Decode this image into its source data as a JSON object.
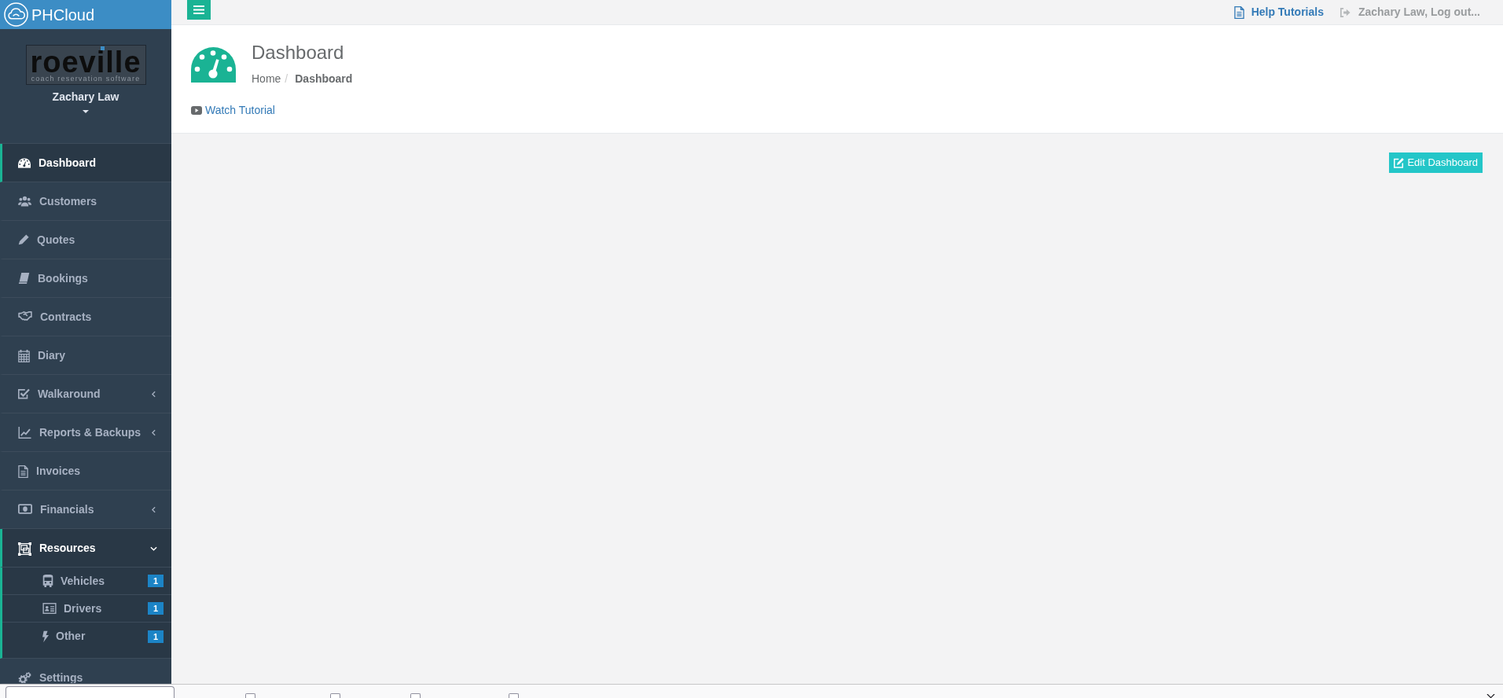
{
  "brand": {
    "name": "PHCloud"
  },
  "profile": {
    "logo": {
      "wordmark": "roeville",
      "tagline": "coach reservation software"
    },
    "user_name": "Zachary Law"
  },
  "sidebar": {
    "items": [
      {
        "kind": "link",
        "label": "Dashboard",
        "selected": true
      },
      {
        "kind": "link",
        "label": "Customers",
        "selected": false
      },
      {
        "kind": "link",
        "label": "Quotes",
        "selected": false
      },
      {
        "kind": "link",
        "label": "Bookings",
        "selected": false
      },
      {
        "kind": "link",
        "label": "Contracts",
        "selected": false
      },
      {
        "kind": "link",
        "label": "Diary",
        "selected": false
      },
      {
        "kind": "submenu",
        "label": "Walkaround",
        "selected": false,
        "expanded": false
      },
      {
        "kind": "submenu",
        "label": "Reports & Backups",
        "selected": false,
        "expanded": false
      },
      {
        "kind": "link",
        "label": "Invoices",
        "selected": false
      },
      {
        "kind": "submenu",
        "label": "Financials",
        "selected": false,
        "expanded": false
      },
      {
        "kind": "submenu",
        "label": "Resources",
        "selected": true,
        "expanded": true,
        "children": [
          {
            "label": "Vehicles",
            "badge": "1",
            "selected": false
          },
          {
            "label": "Drivers",
            "badge": "1",
            "selected": false
          },
          {
            "label": "Other",
            "badge": "1",
            "selected": false
          }
        ]
      },
      {
        "kind": "link",
        "label": "Settings",
        "selected": false
      }
    ]
  },
  "top_bar": {
    "help_link": "Help Tutorials",
    "logout_link": "Zachary Law, Log out..."
  },
  "page_header": {
    "title": "Dashboard",
    "breadcrumb": [
      {
        "label": "Home",
        "current": false
      },
      {
        "label": "Dashboard",
        "current": true
      }
    ],
    "breadcrumb_separator": "/",
    "tutorial_link": "Watch Tutorial"
  },
  "content": {
    "edit_button": "Edit Dashboard"
  },
  "find_bar": {
    "options": [
      {
        "checked": false
      },
      {
        "checked": false
      },
      {
        "checked": false
      },
      {
        "checked": false
      }
    ]
  }
}
